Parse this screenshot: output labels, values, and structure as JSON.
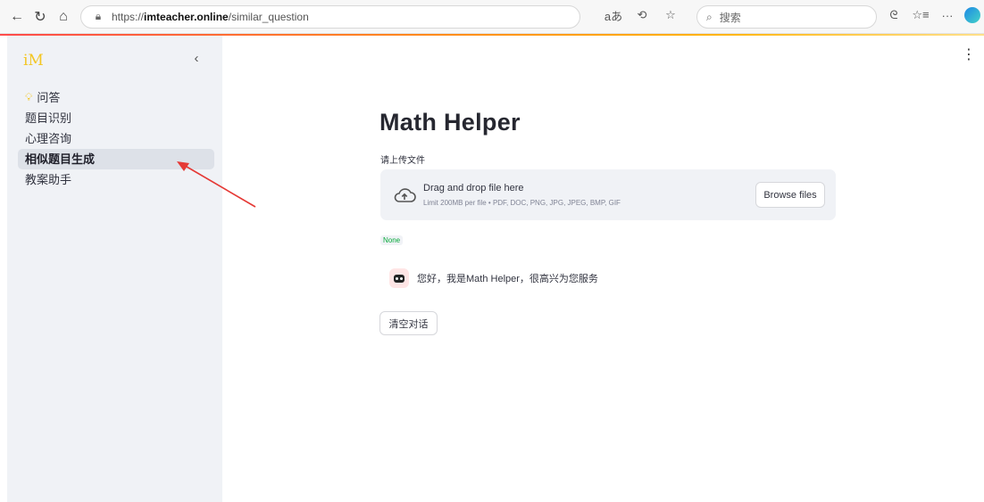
{
  "browser": {
    "url_prefix": "https://",
    "url_domain": "imteacher.online",
    "url_path": "/similar_question",
    "search_placeholder": "搜索"
  },
  "sidebar": {
    "logo": "iM",
    "collapse_icon": "chevron-left-icon",
    "items": [
      {
        "label": "问答",
        "icon": "lightbulb-icon",
        "active": false
      },
      {
        "label": "题目识别",
        "active": false
      },
      {
        "label": "心理咨询",
        "active": false
      },
      {
        "label": "相似题目生成",
        "active": true
      },
      {
        "label": "教案助手",
        "active": false
      }
    ]
  },
  "main": {
    "title": "Math Helper",
    "upload_label": "请上传文件",
    "dropzone": {
      "title": "Drag and drop file here",
      "subtitle": "Limit 200MB per file • PDF, DOC, PNG, JPG, JPEG, BMP, GIF",
      "browse_label": "Browse files"
    },
    "status_value": "None",
    "chat_message": "您好，我是Math Helper，很高兴为您服务",
    "clear_label": "清空对话"
  },
  "colors": {
    "accent": "#ff4b4b",
    "logo": "#f3c623",
    "sidebar_bg": "#f0f2f6",
    "annotation_arrow": "#e53935"
  }
}
